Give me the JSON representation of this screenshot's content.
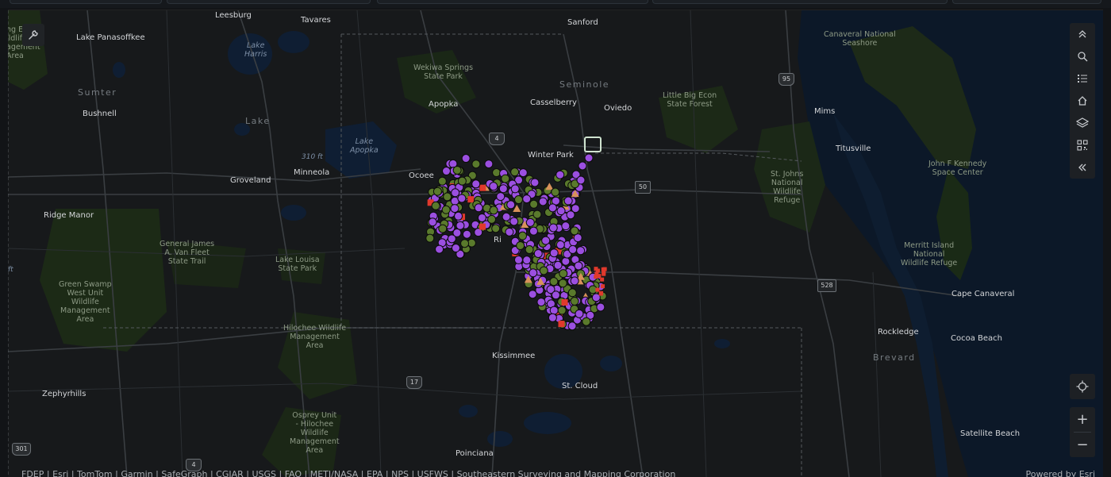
{
  "map": {
    "places": [
      {
        "id": "leesburg",
        "text": "Leesburg",
        "cls": "city"
      },
      {
        "id": "tavares",
        "text": "Tavares",
        "cls": "city"
      },
      {
        "id": "sanford",
        "text": "Sanford",
        "cls": "city"
      },
      {
        "id": "lake-panasoffkee",
        "text": "Lake Panasoffkee",
        "cls": "city"
      },
      {
        "id": "bushnell",
        "text": "Bushnell",
        "cls": "city"
      },
      {
        "id": "apopka",
        "text": "Apopka",
        "cls": "city"
      },
      {
        "id": "casselberry",
        "text": "Casselberry",
        "cls": "city"
      },
      {
        "id": "oviedo",
        "text": "Oviedo",
        "cls": "city"
      },
      {
        "id": "winter-park",
        "text": "Winter Park",
        "cls": "city"
      },
      {
        "id": "ocoee",
        "text": "Ocoee",
        "cls": "city"
      },
      {
        "id": "minneola",
        "text": "Minneola",
        "cls": "city"
      },
      {
        "id": "groveland",
        "text": "Groveland",
        "cls": "city"
      },
      {
        "id": "ridge-manor",
        "text": "Ridge Manor",
        "cls": "city"
      },
      {
        "id": "mims",
        "text": "Mims",
        "cls": "city"
      },
      {
        "id": "titusville",
        "text": "Titusville",
        "cls": "city"
      },
      {
        "id": "cape-canaveral",
        "text": "Cape Canaveral",
        "cls": "city"
      },
      {
        "id": "rockledge",
        "text": "Rockledge",
        "cls": "city"
      },
      {
        "id": "cocoa-beach",
        "text": "Cocoa Beach",
        "cls": "city"
      },
      {
        "id": "kissimmee",
        "text": "Kissimmee",
        "cls": "city"
      },
      {
        "id": "st-cloud",
        "text": "St. Cloud",
        "cls": "city"
      },
      {
        "id": "zephyrhills",
        "text": "Zephyrhills",
        "cls": "city"
      },
      {
        "id": "poinciana",
        "text": "Poinciana",
        "cls": "city"
      },
      {
        "id": "satellite-beach",
        "text": "Satellite Beach",
        "cls": "city"
      },
      {
        "id": "orlando-partial",
        "text": "Ri",
        "cls": "city"
      }
    ],
    "parks": [
      {
        "id": "canaveral-seashore",
        "text": "Canaveral National\nSeashore"
      },
      {
        "id": "wekiwa",
        "text": "Wekiwa Springs\nState Park"
      },
      {
        "id": "little-big-econ",
        "text": "Little Big Econ\nState Forest"
      },
      {
        "id": "st-johns",
        "text": "St. Johns\nNational\nWildlife\nRefuge"
      },
      {
        "id": "jfk",
        "text": "John F Kennedy\nSpace Center"
      },
      {
        "id": "merritt",
        "text": "Merritt Island\nNational\nWildlife Refuge"
      },
      {
        "id": "van-fleet",
        "text": "General James\nA. Van Fleet\nState Trail"
      },
      {
        "id": "lake-louisa",
        "text": "Lake Louisa\nState Park"
      },
      {
        "id": "green-swamp",
        "text": "Green Swamp\nWest Unit\nWildlife\nManagement\nArea"
      },
      {
        "id": "hilochee",
        "text": "Hilochee Wildlife\nManagement\nArea"
      },
      {
        "id": "osprey",
        "text": "Osprey Unit\n- Hilochee\nWildlife\nManagement\nArea"
      },
      {
        "id": "edge-wma",
        "text": "ng E\nildlife\nagement\nArea"
      }
    ],
    "waters": [
      {
        "id": "lake-harris",
        "text": "Lake\nHarris"
      },
      {
        "id": "lake-apopka",
        "text": "Lake\nApopka"
      }
    ],
    "counties": [
      {
        "id": "sumter",
        "text": "Sumter"
      },
      {
        "id": "lake",
        "text": "Lake"
      },
      {
        "id": "seminole",
        "text": "Seminole"
      },
      {
        "id": "brevard",
        "text": "Brevard"
      }
    ],
    "elevations": [
      {
        "id": "elev-310",
        "text": "310 ft"
      },
      {
        "id": "elev-ft",
        "text": "ft"
      }
    ],
    "shields": [
      {
        "id": "i4-north",
        "text": "4",
        "kind": "interstate"
      },
      {
        "id": "i95",
        "text": "95",
        "kind": "interstate"
      },
      {
        "id": "us50",
        "text": "50",
        "kind": "box"
      },
      {
        "id": "sr528",
        "text": "528",
        "kind": "box"
      },
      {
        "id": "us17",
        "text": "17",
        "kind": "us"
      },
      {
        "id": "us301",
        "text": "301",
        "kind": "us"
      },
      {
        "id": "i4-south",
        "text": "4",
        "kind": "interstate"
      }
    ]
  },
  "controls": {
    "collapse": "collapse-icon",
    "search": "search-icon",
    "list": "list-icon",
    "home": "home-icon",
    "layers": "layers-icon",
    "qr": "qr-icon",
    "side_collapse": "double-chevron-left-icon",
    "locate": "locate-icon",
    "zoom_in": "+",
    "zoom_out": "−",
    "tool": "wrench-icon"
  },
  "attribution": "FDEP | Esri | TomTom | Garmin | SafeGraph | CGIAR | USGS | FAO | METI/NASA | EPA | NPS | USFWS | Southeastern Surveying and Mapping Corporation",
  "powered_by": "Powered by Esri",
  "colors": {
    "purple_marker": "#9b4fe0",
    "green_marker": "#5a7a2c",
    "orange_marker": "#d8925a",
    "red_marker": "#e0392c",
    "water": "#0d1a2b",
    "land": "#17191b",
    "green_land": "#1c2818"
  }
}
